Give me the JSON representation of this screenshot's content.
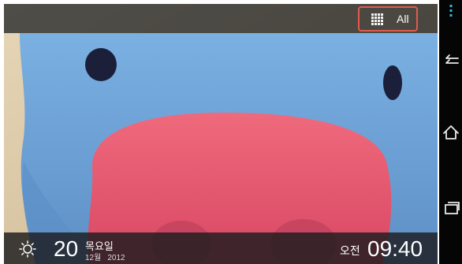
{
  "topbar": {
    "filter_label": "All",
    "filter_icon": "grid-icon"
  },
  "bottombar": {
    "weather_icon": "sun-icon",
    "day": "20",
    "weekday": "목요일",
    "month": "12월",
    "year": "2012",
    "ampm": "오전",
    "time": "09:40"
  },
  "navbar": {
    "icons": [
      "menu-icon",
      "back-icon",
      "home-icon",
      "recent-apps-icon"
    ]
  },
  "colors": {
    "highlight_border": "#e25a4e",
    "figure_blue": "#6fa3d8",
    "figure_pink": "#e7576e",
    "background_wall": "#d9c7a2"
  }
}
